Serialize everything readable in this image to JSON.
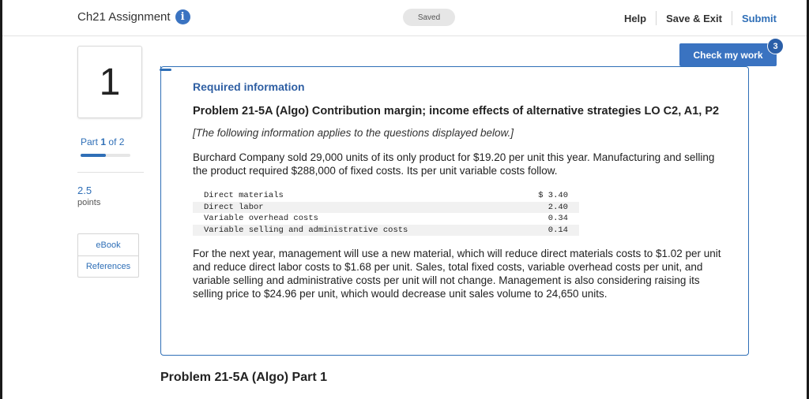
{
  "header": {
    "title": "Ch21 Assignment",
    "saved_label": "Saved",
    "nav": {
      "help": "Help",
      "save_exit": "Save & Exit",
      "submit": "Submit"
    }
  },
  "check_work": {
    "label": "Check my work",
    "badge_count": "3"
  },
  "question": {
    "number": "1",
    "part_prefix": "Part",
    "part_current": "1",
    "part_suffix": "of 2",
    "progress_fraction": 0.5,
    "points_value": "2.5",
    "points_label": "points"
  },
  "side_links": {
    "ebook": "eBook",
    "references": "References"
  },
  "info": {
    "required_label": "Required information",
    "problem_title": "Problem 21-5A (Algo) Contribution margin; income effects of alternative strategies LO C2, A1, P2",
    "applies_note": "[The following information applies to the questions displayed below.]",
    "intro": "Burchard Company sold 29,000 units of its only product for $19.20 per unit this year. Manufacturing and selling the product required $288,000 of fixed costs. Its per unit variable costs follow.",
    "costs": [
      {
        "label": "Direct materials",
        "amount": "$ 3.40"
      },
      {
        "label": "Direct labor",
        "amount": "2.40"
      },
      {
        "label": "Variable overhead costs",
        "amount": "0.34"
      },
      {
        "label": "Variable selling and administrative costs",
        "amount": "0.14"
      }
    ],
    "followup": "For the next year, management will use a new material, which will reduce direct materials costs to $1.02 per unit and reduce direct labor costs to $1.68 per unit. Sales, total fixed costs, variable overhead costs per unit, and variable selling and administrative costs per unit will not change. Management is also considering raising its selling price to $24.96 per unit, which would decrease unit sales volume to 24,650 units."
  },
  "part_heading": "Problem 21-5A (Algo) Part 1"
}
